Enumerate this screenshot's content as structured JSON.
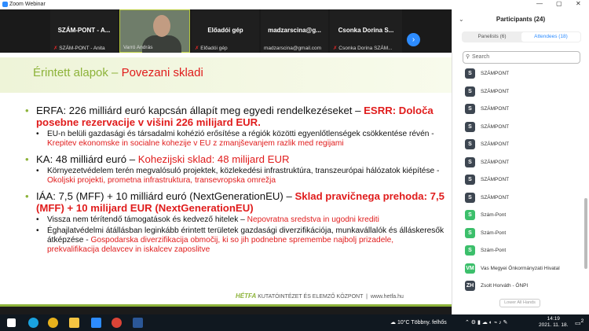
{
  "window": {
    "title": "Zoom Webinar",
    "controls": [
      "—",
      "▢",
      "✕"
    ]
  },
  "gallery": {
    "tiles": [
      {
        "name": "SZÁM-PONT - A...",
        "label": "SZÁM-PONT - Anita",
        "muted": true
      },
      {
        "name": "",
        "label": "Varró András",
        "muted": false,
        "video": true
      },
      {
        "name": "Előadói gép",
        "label": "Előadói gép",
        "muted": true
      },
      {
        "name": "madzarscina@g...",
        "label": "madzarscina@gmail.com",
        "muted": false
      },
      {
        "name": "Csonka Dorina S...",
        "label": "Csonka Dorina SZÁM...",
        "muted": true
      }
    ],
    "next_icon": "chevron-right-icon"
  },
  "slide": {
    "title_green": "Érintett alapok – ",
    "title_red": "Povezani skladi",
    "bullets": [
      {
        "text": "ERFA: 226 milliárd euró kapcsán állapít meg egyedi rendelkezéseket – ",
        "red": "ESRR: Določa posebne rezervacije v višini 226 milijard EUR.",
        "subs": [
          {
            "text": "EU-n belüli gazdasági és társadalmi kohézió erősítése a régiók közötti egyenlőtlenségek csökkentése révén - ",
            "red": "Krepitev ekonomske in socialne kohezije v EU z zmanjševanjem razlik med regijami"
          }
        ]
      },
      {
        "text": "KA: 48 milliárd euró – ",
        "red": "Kohezijski sklad: 48 milijard EUR",
        "subs": [
          {
            "text": "Környezetvédelem terén megvalósuló projektek, közlekedési infrastruktúra, transzeurópai hálózatok kiépítése - ",
            "red": "Okoljski projekti, prometna infrastruktura, transevropska omrežja"
          }
        ]
      },
      {
        "text": "IÁA: 7,5 (MFF) + 10 milliárd euró (NextGenerationEU) – ",
        "red": "Sklad pravičnega prehoda: 7,5 (MFF) + 10 milijard EUR (NextGenerationEU)",
        "subs": [
          {
            "text": "Vissza nem térítendő támogatások és kedvező hitelek – ",
            "red": "Nepovratna sredstva in ugodni krediti"
          },
          {
            "text": "Éghajlatvédelmi átállásban leginkább érintett területek gazdasági diverzifikációja, munkavállalók és álláskeresők átképzése - ",
            "red": "Gospodarska diverzifikacija območij, ki so jih podnebne spremembe najbolj prizadele, prekvalifikacija delavcev in iskalcev zaposlitve"
          }
        ]
      }
    ],
    "footer_logo": "HÉTFA",
    "footer_text": "KUTATÓINTÉZET ÉS ELEMZŐ KÖZPONT",
    "footer_url": "www.hetfa.hu"
  },
  "participants": {
    "title": "Participants (24)",
    "tabs": [
      "Panelists (6)",
      "Attendees (18)"
    ],
    "search_placeholder": "Search",
    "list": [
      {
        "initials": "S",
        "name": "SZÁMPONT",
        "color": "#3d4651"
      },
      {
        "initials": "S",
        "name": "SZÁMPONT",
        "color": "#3d4651"
      },
      {
        "initials": "S",
        "name": "SZÁMPONT",
        "color": "#3d4651"
      },
      {
        "initials": "S",
        "name": "SZÁMPONT",
        "color": "#3d4651"
      },
      {
        "initials": "S",
        "name": "SZÁMPONT",
        "color": "#3d4651"
      },
      {
        "initials": "S",
        "name": "SZÁMPONT",
        "color": "#3d4651"
      },
      {
        "initials": "S",
        "name": "SZÁMPONT",
        "color": "#3d4651"
      },
      {
        "initials": "S",
        "name": "SZÁMPONT",
        "color": "#3d4651"
      },
      {
        "initials": "S",
        "name": "Szám-Pont",
        "color": "#3cbf6b"
      },
      {
        "initials": "S",
        "name": "Szám-Pont",
        "color": "#3cbf6b"
      },
      {
        "initials": "S",
        "name": "Szám-Pont",
        "color": "#3cbf6b"
      },
      {
        "initials": "VM",
        "name": "Vas Megyei Önkormányzati Hivatal",
        "color": "#3cbf6b"
      },
      {
        "initials": "ZH",
        "name": "Zsolt Horváth - ÖNPI",
        "color": "#3d4651"
      }
    ],
    "lower_hands": "Lower All Hands"
  },
  "taskbar": {
    "weather": "10°C  Többny. felhős",
    "time": "14:19",
    "date": "2021. 11. 18.",
    "notif_count": "2"
  }
}
